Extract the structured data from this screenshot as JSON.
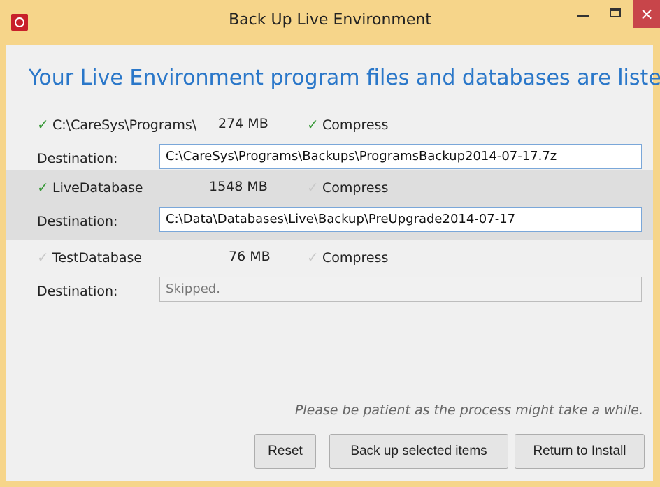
{
  "window": {
    "title": "Back Up Live Environment",
    "close_glyph": "×"
  },
  "heading": "Your Live Environment program files and databases are listed below",
  "items": [
    {
      "checked": true,
      "name": "C:\\CareSys\\Programs\\",
      "size": "274 MB",
      "compress_checked": true,
      "compress_label": "Compress",
      "destination_label": "Destination:",
      "destination": "C:\\CareSys\\Programs\\Backups\\ProgramsBackup2014-07-17.7z"
    },
    {
      "checked": true,
      "name": "LiveDatabase",
      "size": "1548 MB",
      "compress_checked": false,
      "compress_label": "Compress",
      "destination_label": "Destination:",
      "destination": "C:\\Data\\Databases\\Live\\Backup\\PreUpgrade2014-07-17"
    },
    {
      "checked": false,
      "name": "TestDatabase",
      "size": "76 MB",
      "compress_checked": false,
      "compress_label": "Compress",
      "destination_label": "Destination:",
      "destination": "Skipped."
    }
  ],
  "note": "Please be patient as the process might take a while.",
  "buttons": {
    "reset": "Reset",
    "backup": "Back up selected items",
    "return": "Return to Install"
  },
  "colors": {
    "accent": "#2a77c9",
    "check_on": "#3a9a3a",
    "check_off": "#c9c9c9",
    "title_bar": "#f6d58a",
    "close": "#c8454a"
  },
  "icons": {
    "check": "✓"
  }
}
